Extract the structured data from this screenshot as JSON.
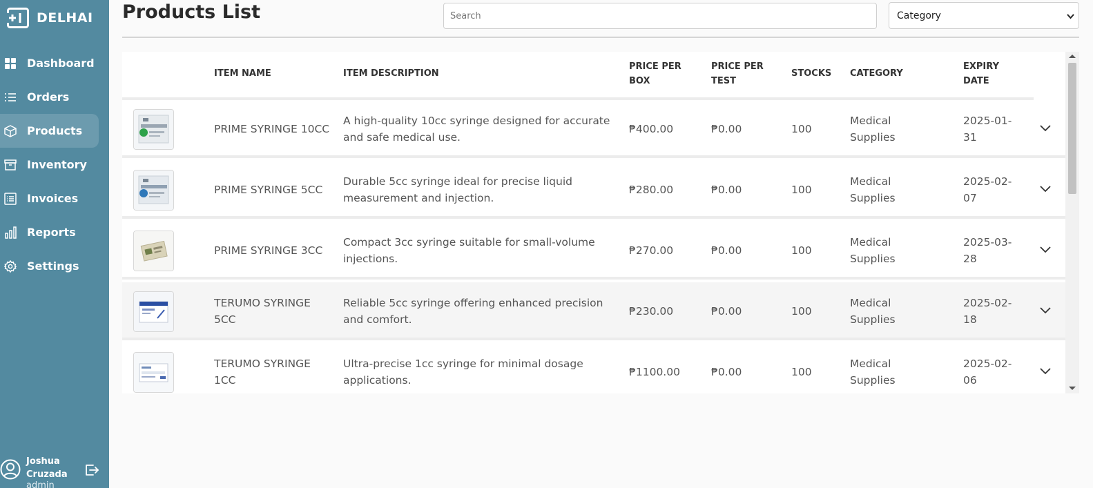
{
  "app": {
    "brand": "DELHAI"
  },
  "sidebar": {
    "items": [
      {
        "label": "Dashboard",
        "icon": "grid-icon",
        "active": false
      },
      {
        "label": "Orders",
        "icon": "list-icon",
        "active": false
      },
      {
        "label": "Products",
        "icon": "box-icon",
        "active": true
      },
      {
        "label": "Inventory",
        "icon": "archive-icon",
        "active": false
      },
      {
        "label": "Invoices",
        "icon": "receipt-icon",
        "active": false
      },
      {
        "label": "Reports",
        "icon": "bar-chart-icon",
        "active": false
      },
      {
        "label": "Settings",
        "icon": "gear-icon",
        "active": false
      }
    ]
  },
  "user": {
    "name": "Joshua Cruzada",
    "role": "admin"
  },
  "header": {
    "title": "Products List",
    "search_placeholder": "Search",
    "category_selected": "Category"
  },
  "table": {
    "columns": {
      "name": "ITEM NAME",
      "description": "ITEM DESCRIPTION",
      "price_box": "PRICE PER BOX",
      "price_test": "PRICE PER TEST",
      "stocks": "STOCKS",
      "category": "CATEGORY",
      "expiry": "EXPIRY DATE"
    },
    "rows": [
      {
        "name": "PRIME SYRINGE 10CC",
        "description": "A high-quality 10cc syringe designed for accurate and safe medical use.",
        "price_box": "₱400.00",
        "price_test": "₱0.00",
        "stocks": "100",
        "category": "Medical Supplies",
        "expiry": "2025-01-31"
      },
      {
        "name": "PRIME SYRINGE 5CC",
        "description": "Durable 5cc syringe ideal for precise liquid measurement and injection.",
        "price_box": "₱280.00",
        "price_test": "₱0.00",
        "stocks": "100",
        "category": "Medical Supplies",
        "expiry": "2025-02-07"
      },
      {
        "name": "PRIME SYRINGE 3CC",
        "description": "Compact 3cc syringe suitable for small-volume injections.",
        "price_box": "₱270.00",
        "price_test": "₱0.00",
        "stocks": "100",
        "category": "Medical Supplies",
        "expiry": "2025-03-28"
      },
      {
        "name": "TERUMO SYRINGE 5CC",
        "description": "Reliable 5cc syringe offering enhanced precision and comfort.",
        "price_box": "₱230.00",
        "price_test": "₱0.00",
        "stocks": "100",
        "category": "Medical Supplies",
        "expiry": "2025-02-18"
      },
      {
        "name": "TERUMO SYRINGE 1CC",
        "description": "Ultra-precise 1cc syringe for minimal dosage applications.",
        "price_box": "₱1100.00",
        "price_test": "₱0.00",
        "stocks": "100",
        "category": "Medical Supplies",
        "expiry": "2025-02-06"
      }
    ]
  },
  "colors": {
    "sidebar": "#538aa0",
    "background": "#fafafa",
    "text": "#333333"
  }
}
